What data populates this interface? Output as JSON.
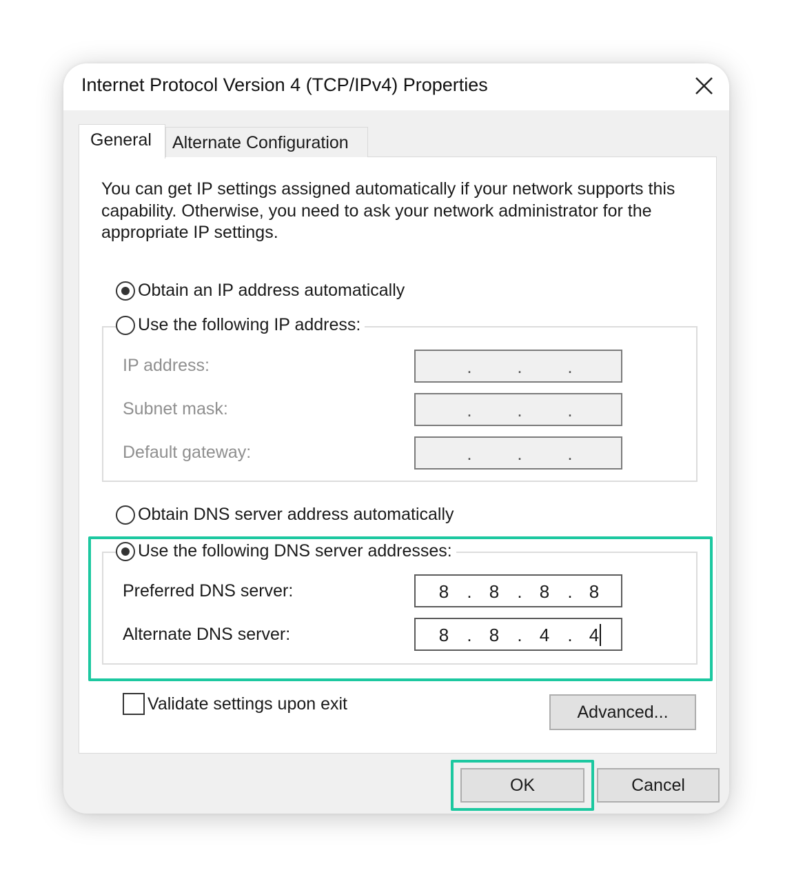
{
  "window": {
    "title": "Internet Protocol Version 4 (TCP/IPv4) Properties",
    "close_icon": "close-icon"
  },
  "tabs": [
    {
      "label": "General",
      "selected": true
    },
    {
      "label": "Alternate Configuration",
      "selected": false
    }
  ],
  "general": {
    "intro": "You can get IP settings assigned automatically if your network supports this capability. Otherwise, you need to ask your network administrator for the appropriate IP settings.",
    "ip_mode": {
      "auto_label": "Obtain an IP address automatically",
      "manual_label": "Use the following IP address:",
      "selected": "auto"
    },
    "ip_fields": {
      "ip_address": {
        "label": "IP address:",
        "octets": [
          "",
          "",
          "",
          ""
        ],
        "enabled": false
      },
      "subnet_mask": {
        "label": "Subnet mask:",
        "octets": [
          "",
          "",
          "",
          ""
        ],
        "enabled": false
      },
      "default_gateway": {
        "label": "Default gateway:",
        "octets": [
          "",
          "",
          "",
          ""
        ],
        "enabled": false
      }
    },
    "dns_mode": {
      "auto_label": "Obtain DNS server address automatically",
      "manual_label": "Use the following DNS server addresses:",
      "selected": "manual"
    },
    "dns_fields": {
      "preferred": {
        "label": "Preferred DNS server:",
        "octets": [
          "8",
          "8",
          "8",
          "8"
        ]
      },
      "alternate": {
        "label": "Alternate DNS server:",
        "octets": [
          "8",
          "8",
          "4",
          "4"
        ]
      }
    },
    "validate": {
      "label": "Validate settings upon exit",
      "checked": false
    },
    "advanced_label": "Advanced...",
    "dot": "."
  },
  "footer": {
    "ok_label": "OK",
    "cancel_label": "Cancel"
  },
  "colors": {
    "highlight": "#1cc8a0",
    "dialog_bg": "#f0f0f0",
    "panel_bg": "#ffffff",
    "button_bg": "#e1e1e1"
  }
}
